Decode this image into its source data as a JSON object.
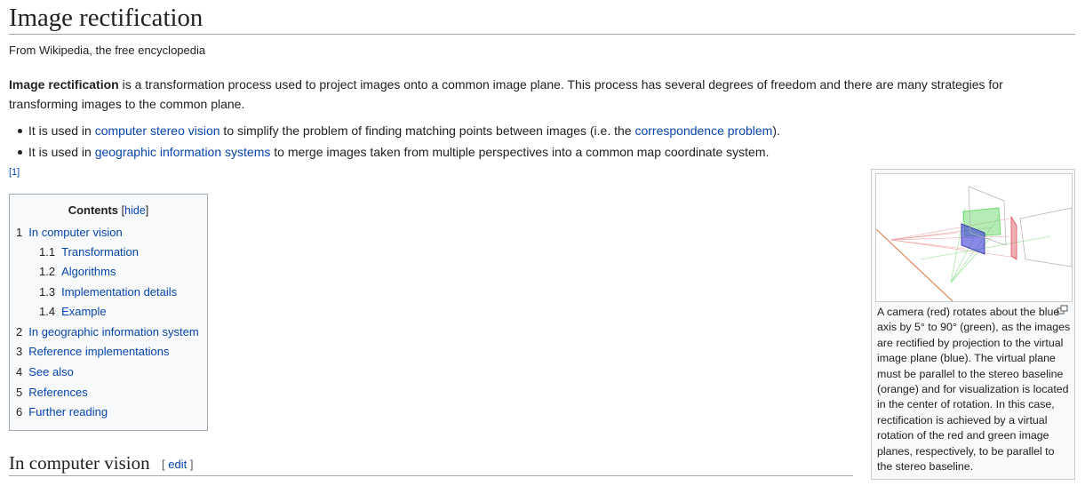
{
  "page": {
    "title": "Image rectification",
    "tagline": "From Wikipedia, the free encyclopedia"
  },
  "intro": {
    "bold_term": "Image rectification",
    "text": " is a transformation process used to project images onto a common image plane. This process has several degrees of freedom and there are many strategies for transforming images to the common plane."
  },
  "bullets": [
    {
      "prefix": "It is used in ",
      "link1": "computer stereo vision",
      "middle": " to simplify the problem of finding matching points between images (i.e. the ",
      "link2": "correspondence problem",
      "suffix": ")."
    },
    {
      "prefix": "It is used in ",
      "link1": "geographic information systems",
      "suffix": " to merge images taken from multiple perspectives into a common map coordinate system."
    }
  ],
  "citation": "[1]",
  "toc": {
    "title": "Contents",
    "bracket_open": "[",
    "hide_label": "hide",
    "bracket_close": "]",
    "items": [
      {
        "num": "1",
        "label": "In computer vision"
      },
      {
        "num": "1.1",
        "label": "Transformation"
      },
      {
        "num": "1.2",
        "label": "Algorithms"
      },
      {
        "num": "1.3",
        "label": "Implementation details"
      },
      {
        "num": "1.4",
        "label": "Example"
      },
      {
        "num": "2",
        "label": "In geographic information system"
      },
      {
        "num": "3",
        "label": "Reference implementations"
      },
      {
        "num": "4",
        "label": "See also"
      },
      {
        "num": "5",
        "label": "References"
      },
      {
        "num": "6",
        "label": "Further reading"
      }
    ]
  },
  "figure": {
    "caption": "A camera (red) rotates about the blue axis by 5° to 90° (green), as the images are rectified by projection to the virtual image plane (blue). The virtual plane must be parallel to the stereo baseline (orange) and for visualization is located in the center of rotation. In this case, rectification is achieved by a virtual rotation of the red and green image planes, respectively, to be parallel to the stereo baseline.",
    "enlarge_icon": "enlarge-icon"
  },
  "section": {
    "title": "In computer vision",
    "edit_open": "[",
    "edit_label": "edit",
    "edit_close": "]"
  },
  "colors": {
    "link": "#0645ad",
    "text": "#202122",
    "toc_background": "#f8f9fa",
    "border": "#a2a9b1",
    "camera_red": "#e0505a",
    "rotated_green": "#5ad45a",
    "virtual_blue": "#3a3ad8",
    "baseline_orange": "#e0703a"
  }
}
